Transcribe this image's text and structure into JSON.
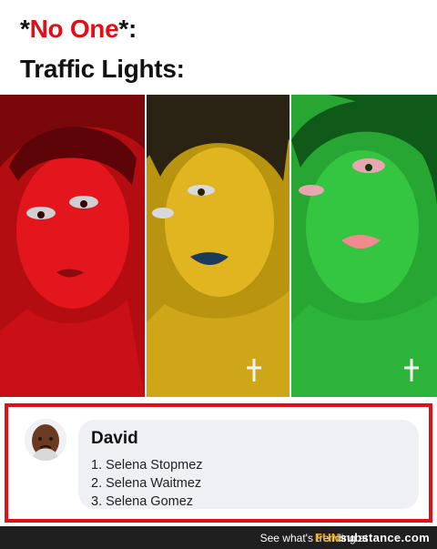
{
  "caption": {
    "line1_prefix": "*",
    "line1_highlight": "No One",
    "line1_suffix": "*:",
    "line2": "Traffic Lights:"
  },
  "panels": [
    {
      "tint": "red",
      "color": "#e3161d"
    },
    {
      "tint": "yellow",
      "color": "#d9b21b"
    },
    {
      "tint": "green",
      "color": "#2fbf3c"
    }
  ],
  "comment": {
    "author": "David",
    "lines": [
      "1. Selena Stopmez",
      "2. Selena Waitmez",
      "3. Selena Gomez"
    ],
    "frame_color": "#e0101a"
  },
  "footer": {
    "text": "See what's trending at",
    "brand_part1": "FUN",
    "brand_part2": "substance.com"
  }
}
